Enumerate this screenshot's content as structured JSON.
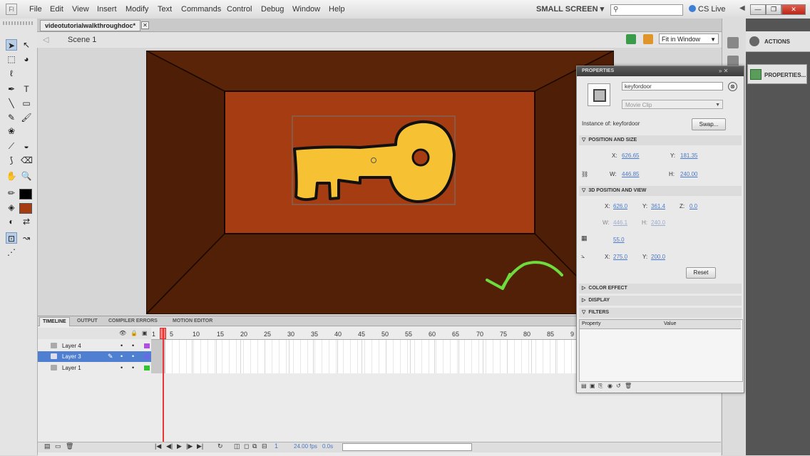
{
  "menubar": {
    "app_logo": "Fl",
    "items": [
      "File",
      "Edit",
      "View",
      "Insert",
      "Modify",
      "Text",
      "Commands",
      "Control",
      "Debug",
      "Window",
      "Help"
    ],
    "workspace": "SMALL SCREEN ▾",
    "cs_live": "CS Live",
    "search_icon": "magnifier-icon"
  },
  "document": {
    "tab": "videotutorialwalkthroughdoc*",
    "scene": "Scene 1",
    "zoom": "Fit in Window"
  },
  "timeline": {
    "tabs": [
      "TIMELINE",
      "OUTPUT",
      "COMPILER ERRORS",
      "MOTION EDITOR"
    ],
    "frame_numbers": [
      "1",
      "5",
      "10",
      "15",
      "20",
      "25",
      "30",
      "35",
      "40",
      "45",
      "50",
      "55",
      "60",
      "65",
      "70",
      "75",
      "80",
      "85",
      "9"
    ],
    "layers": [
      {
        "name": "Layer 4",
        "color": "#b04fe0",
        "selected": false
      },
      {
        "name": "Layer 3",
        "color": "#6a6ae6",
        "selected": true
      },
      {
        "name": "Layer 1",
        "color": "#31c431",
        "selected": false
      }
    ],
    "fps": "24.00 fps",
    "time": "0.0s",
    "frame": "1"
  },
  "dock": {
    "actions_label": "ACTIONS",
    "properties_label": "PROPERTIES..."
  },
  "properties": {
    "title": "PROPERTIES",
    "instance_name": "keyfordoor",
    "symbol_type": "Movie Clip",
    "instance_of_label": "Instance of:",
    "instance_of_value": "keyfordoor",
    "swap_label": "Swap...",
    "sections": {
      "position_size": "POSITION AND SIZE",
      "position_3d": "3D POSITION AND VIEW",
      "color_effect": "COLOR EFFECT",
      "display": "DISPLAY",
      "filters": "FILTERS"
    },
    "pos": {
      "x_label": "X:",
      "x": "626.65",
      "y_label": "Y:",
      "y": "181.35",
      "w_label": "W:",
      "w": "446.85",
      "h_label": "H:",
      "h": "240.00"
    },
    "pos3d": {
      "x_label": "X:",
      "x": "626.0",
      "y_label": "Y:",
      "y": "361.4",
      "z_label": "Z:",
      "z": "0.0",
      "w_label": "W:",
      "w": "446.1",
      "h_label": "H:",
      "h": "240.0"
    },
    "perspective": "55.0",
    "vanishing": {
      "x_label": "X:",
      "x": "275.0",
      "y_label": "Y:",
      "y": "200.0"
    },
    "reset_label": "Reset",
    "filters_columns": [
      "Property",
      "Value"
    ]
  },
  "colors": {
    "stage_dark": "#4a1d06",
    "back_wall": "#a63c12",
    "key_fill": "#f6c234",
    "arrow": "#6edc3c",
    "stroke_color": "#000000",
    "fill_color": "#a63c12"
  }
}
